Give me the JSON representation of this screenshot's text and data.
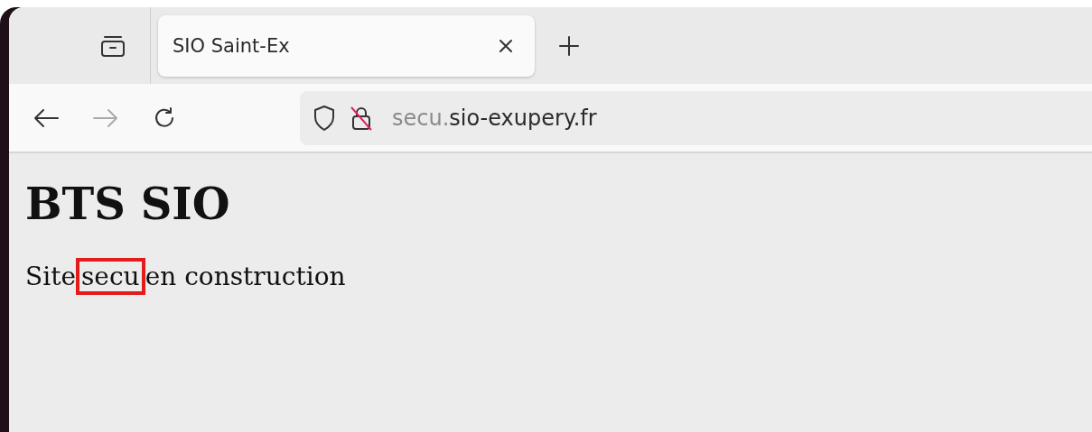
{
  "tabs": [
    {
      "title": "SIO Saint-Ex",
      "selected": true
    }
  ],
  "address_bar": {
    "subdomain": "secu.",
    "domain": "sio-exupery.fr"
  },
  "nav": {
    "back_disabled": false,
    "forward_disabled": true
  },
  "page": {
    "heading": "BTS SIO",
    "paragraph": {
      "before": "Site",
      "highlighted": "secu",
      "after": "en construction"
    }
  }
}
